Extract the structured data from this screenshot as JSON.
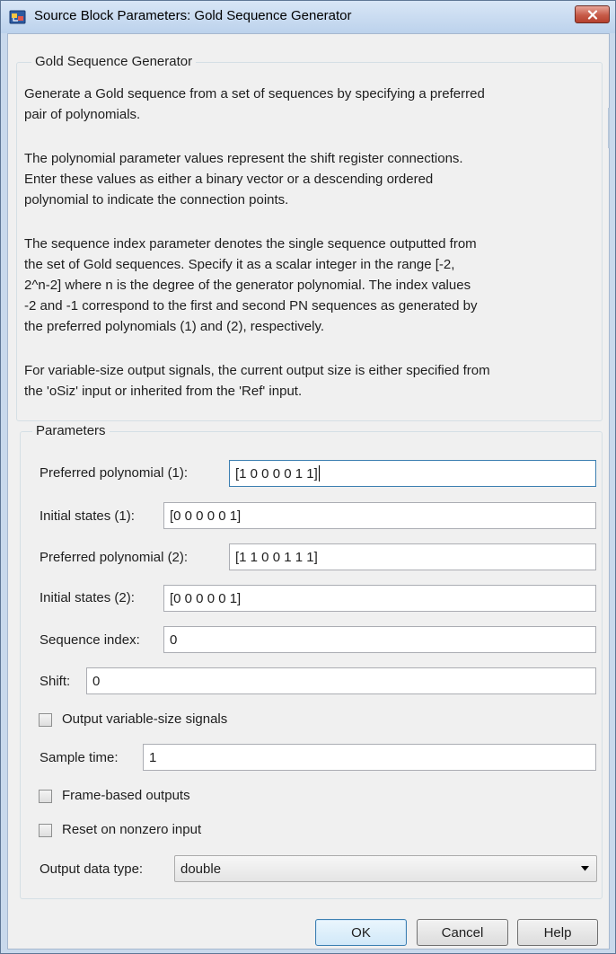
{
  "window": {
    "title": "Source Block Parameters: Gold Sequence Generator",
    "icon": "simulink-block-icon",
    "close_icon": "close-icon"
  },
  "description": {
    "group_title": "Gold Sequence Generator",
    "lines": [
      "Generate a Gold sequence from a set of sequences by specifying a preferred",
      "pair of polynomials.",
      "",
      "The polynomial parameter values represent the shift register connections.",
      "Enter these values as either a binary vector or a descending ordered",
      "polynomial to indicate the connection points.",
      "",
      "The sequence index parameter denotes the single sequence outputted from",
      "the set of Gold sequences. Specify it as a scalar integer in the range [-2,",
      "2^n-2] where n is the degree of the generator polynomial. The index values",
      "-2 and -1 correspond to the first and second PN sequences as generated by",
      "the preferred polynomials (1) and (2), respectively.",
      "",
      "For variable-size output signals, the current output size is either specified from",
      "the 'oSiz' input or inherited from the 'Ref' input."
    ]
  },
  "parameters": {
    "group_title": "Parameters",
    "preferred_poly_1": {
      "label": "Preferred polynomial (1):",
      "value": "[1 0 0 0 0 1 1]"
    },
    "initial_states_1": {
      "label": "Initial states (1):",
      "value": "[0 0 0 0 0 1]"
    },
    "preferred_poly_2": {
      "label": "Preferred polynomial (2):",
      "value": "[1 1 0 0 1 1 1]"
    },
    "initial_states_2": {
      "label": "Initial states (2):",
      "value": "[0 0 0 0 0 1]"
    },
    "sequence_index": {
      "label": "Sequence index:",
      "value": "0"
    },
    "shift": {
      "label": "Shift:",
      "value": "0"
    },
    "output_variable_size": {
      "label": "Output variable-size signals",
      "checked": false
    },
    "sample_time": {
      "label": "Sample time:",
      "value": "1"
    },
    "frame_based_outputs": {
      "label": "Frame-based outputs",
      "checked": false
    },
    "reset_on_nonzero": {
      "label": "Reset on nonzero input",
      "checked": false
    },
    "output_data_type": {
      "label": "Output data type:",
      "value": "double"
    }
  },
  "buttons": {
    "ok": "OK",
    "cancel": "Cancel",
    "help": "Help"
  },
  "colors": {
    "title_bar": "#c9d9ec",
    "client_bg": "#f0f0f0",
    "close_button": "#c75b48",
    "focus_border": "#3c7fb1"
  }
}
